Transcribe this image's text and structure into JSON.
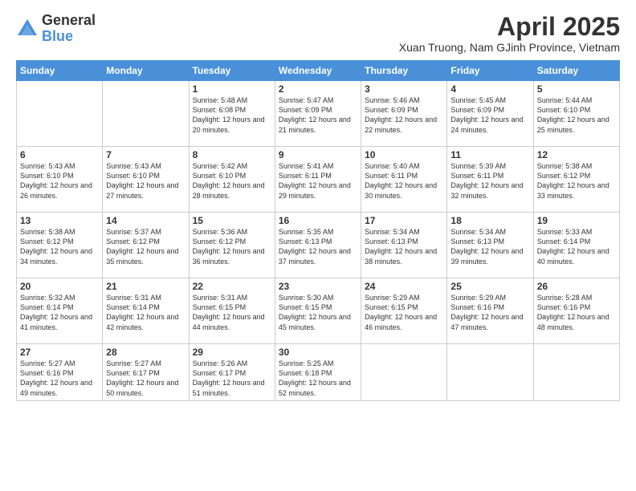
{
  "logo": {
    "general": "General",
    "blue": "Blue"
  },
  "title": "April 2025",
  "subtitle": "Xuan Truong, Nam GJinh Province, Vietnam",
  "days_header": [
    "Sunday",
    "Monday",
    "Tuesday",
    "Wednesday",
    "Thursday",
    "Friday",
    "Saturday"
  ],
  "weeks": [
    [
      {
        "day": "",
        "info": ""
      },
      {
        "day": "",
        "info": ""
      },
      {
        "day": "1",
        "info": "Sunrise: 5:48 AM\nSunset: 6:08 PM\nDaylight: 12 hours and 20 minutes."
      },
      {
        "day": "2",
        "info": "Sunrise: 5:47 AM\nSunset: 6:09 PM\nDaylight: 12 hours and 21 minutes."
      },
      {
        "day": "3",
        "info": "Sunrise: 5:46 AM\nSunset: 6:09 PM\nDaylight: 12 hours and 22 minutes."
      },
      {
        "day": "4",
        "info": "Sunrise: 5:45 AM\nSunset: 6:09 PM\nDaylight: 12 hours and 24 minutes."
      },
      {
        "day": "5",
        "info": "Sunrise: 5:44 AM\nSunset: 6:10 PM\nDaylight: 12 hours and 25 minutes."
      }
    ],
    [
      {
        "day": "6",
        "info": "Sunrise: 5:43 AM\nSunset: 6:10 PM\nDaylight: 12 hours and 26 minutes."
      },
      {
        "day": "7",
        "info": "Sunrise: 5:43 AM\nSunset: 6:10 PM\nDaylight: 12 hours and 27 minutes."
      },
      {
        "day": "8",
        "info": "Sunrise: 5:42 AM\nSunset: 6:10 PM\nDaylight: 12 hours and 28 minutes."
      },
      {
        "day": "9",
        "info": "Sunrise: 5:41 AM\nSunset: 6:11 PM\nDaylight: 12 hours and 29 minutes."
      },
      {
        "day": "10",
        "info": "Sunrise: 5:40 AM\nSunset: 6:11 PM\nDaylight: 12 hours and 30 minutes."
      },
      {
        "day": "11",
        "info": "Sunrise: 5:39 AM\nSunset: 6:11 PM\nDaylight: 12 hours and 32 minutes."
      },
      {
        "day": "12",
        "info": "Sunrise: 5:38 AM\nSunset: 6:12 PM\nDaylight: 12 hours and 33 minutes."
      }
    ],
    [
      {
        "day": "13",
        "info": "Sunrise: 5:38 AM\nSunset: 6:12 PM\nDaylight: 12 hours and 34 minutes."
      },
      {
        "day": "14",
        "info": "Sunrise: 5:37 AM\nSunset: 6:12 PM\nDaylight: 12 hours and 35 minutes."
      },
      {
        "day": "15",
        "info": "Sunrise: 5:36 AM\nSunset: 6:12 PM\nDaylight: 12 hours and 36 minutes."
      },
      {
        "day": "16",
        "info": "Sunrise: 5:35 AM\nSunset: 6:13 PM\nDaylight: 12 hours and 37 minutes."
      },
      {
        "day": "17",
        "info": "Sunrise: 5:34 AM\nSunset: 6:13 PM\nDaylight: 12 hours and 38 minutes."
      },
      {
        "day": "18",
        "info": "Sunrise: 5:34 AM\nSunset: 6:13 PM\nDaylight: 12 hours and 39 minutes."
      },
      {
        "day": "19",
        "info": "Sunrise: 5:33 AM\nSunset: 6:14 PM\nDaylight: 12 hours and 40 minutes."
      }
    ],
    [
      {
        "day": "20",
        "info": "Sunrise: 5:32 AM\nSunset: 6:14 PM\nDaylight: 12 hours and 41 minutes."
      },
      {
        "day": "21",
        "info": "Sunrise: 5:31 AM\nSunset: 6:14 PM\nDaylight: 12 hours and 42 minutes."
      },
      {
        "day": "22",
        "info": "Sunrise: 5:31 AM\nSunset: 6:15 PM\nDaylight: 12 hours and 44 minutes."
      },
      {
        "day": "23",
        "info": "Sunrise: 5:30 AM\nSunset: 6:15 PM\nDaylight: 12 hours and 45 minutes."
      },
      {
        "day": "24",
        "info": "Sunrise: 5:29 AM\nSunset: 6:15 PM\nDaylight: 12 hours and 46 minutes."
      },
      {
        "day": "25",
        "info": "Sunrise: 5:29 AM\nSunset: 6:16 PM\nDaylight: 12 hours and 47 minutes."
      },
      {
        "day": "26",
        "info": "Sunrise: 5:28 AM\nSunset: 6:16 PM\nDaylight: 12 hours and 48 minutes."
      }
    ],
    [
      {
        "day": "27",
        "info": "Sunrise: 5:27 AM\nSunset: 6:16 PM\nDaylight: 12 hours and 49 minutes."
      },
      {
        "day": "28",
        "info": "Sunrise: 5:27 AM\nSunset: 6:17 PM\nDaylight: 12 hours and 50 minutes."
      },
      {
        "day": "29",
        "info": "Sunrise: 5:26 AM\nSunset: 6:17 PM\nDaylight: 12 hours and 51 minutes."
      },
      {
        "day": "30",
        "info": "Sunrise: 5:25 AM\nSunset: 6:18 PM\nDaylight: 12 hours and 52 minutes."
      },
      {
        "day": "",
        "info": ""
      },
      {
        "day": "",
        "info": ""
      },
      {
        "day": "",
        "info": ""
      }
    ]
  ]
}
